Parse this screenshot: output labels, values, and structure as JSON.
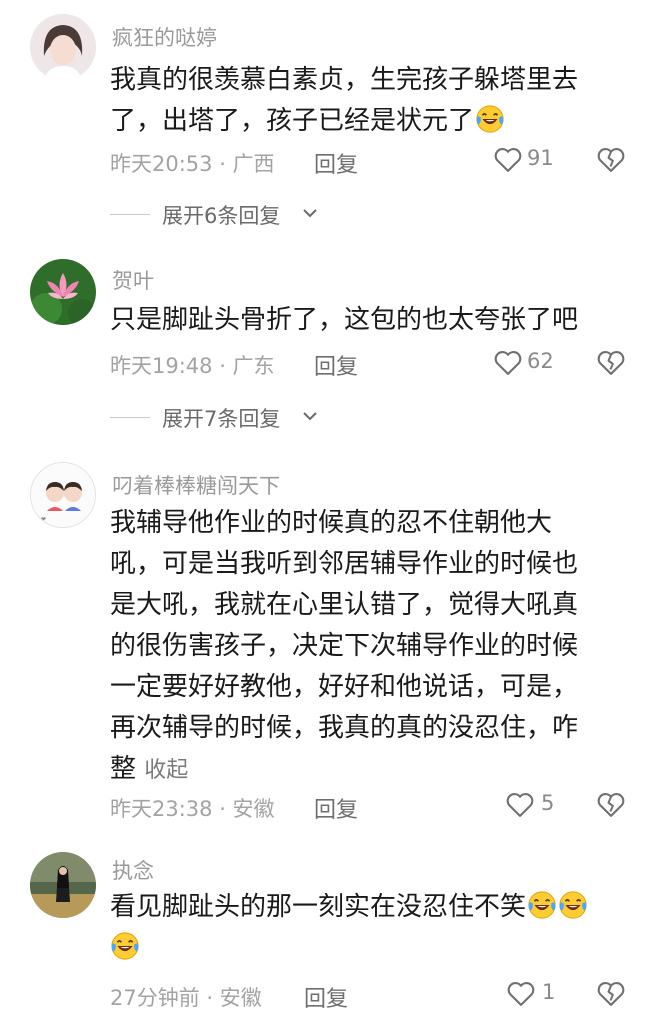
{
  "comments": [
    {
      "username": "疯狂的哒婷",
      "text_lines": [
        "我真的很羡慕白素贞，生完孩子躲塔里去",
        "了，出塔了，孩子已经是状元了"
      ],
      "emoji_count": 1,
      "meta": "昨天20:53 · 广西",
      "reply_label": "回复",
      "likes": "91",
      "expand_label": "展开6条回复"
    },
    {
      "username": "贺叶",
      "text_lines": [
        "只是脚趾头骨折了，这包的也太夸张了吧"
      ],
      "meta": "昨天19:48 · 广东",
      "reply_label": "回复",
      "likes": "62",
      "expand_label": "展开7条回复"
    },
    {
      "username": "叼着棒棒糖闯天下",
      "text_lines": [
        "我辅导他作业的时候真的忍不住朝他大",
        "吼，可是当我听到邻居辅导作业的时候也",
        "是大吼，我就在心里认错了，觉得大吼真",
        "的很伤害孩子，决定下次辅导作业的时候",
        "一定要好好教他，好好和他说话，可是，",
        "再次辅导的时候，我真的真的没忍住，咋",
        "整"
      ],
      "collapse_label": "收起",
      "meta": "昨天23:38 · 安徽",
      "reply_label": "回复",
      "likes": "5"
    },
    {
      "username": "执念",
      "text_lines": [
        "看见脚趾头的那一刻实在没忍住不笑"
      ],
      "emoji_count": 3,
      "meta": "27分钟前 · 安徽",
      "reply_label": "回复",
      "likes": "1"
    }
  ],
  "icons": {
    "like": "heart-outline-icon",
    "dislike": "broken-heart-icon",
    "expand": "chevron-down-icon",
    "emoji": "laughing-tears-emoji-icon"
  },
  "colors": {
    "text": "#1a1a1a",
    "meta": "#a3a3a3",
    "username": "#9a9a9a",
    "icon": "#6f6f6f"
  }
}
